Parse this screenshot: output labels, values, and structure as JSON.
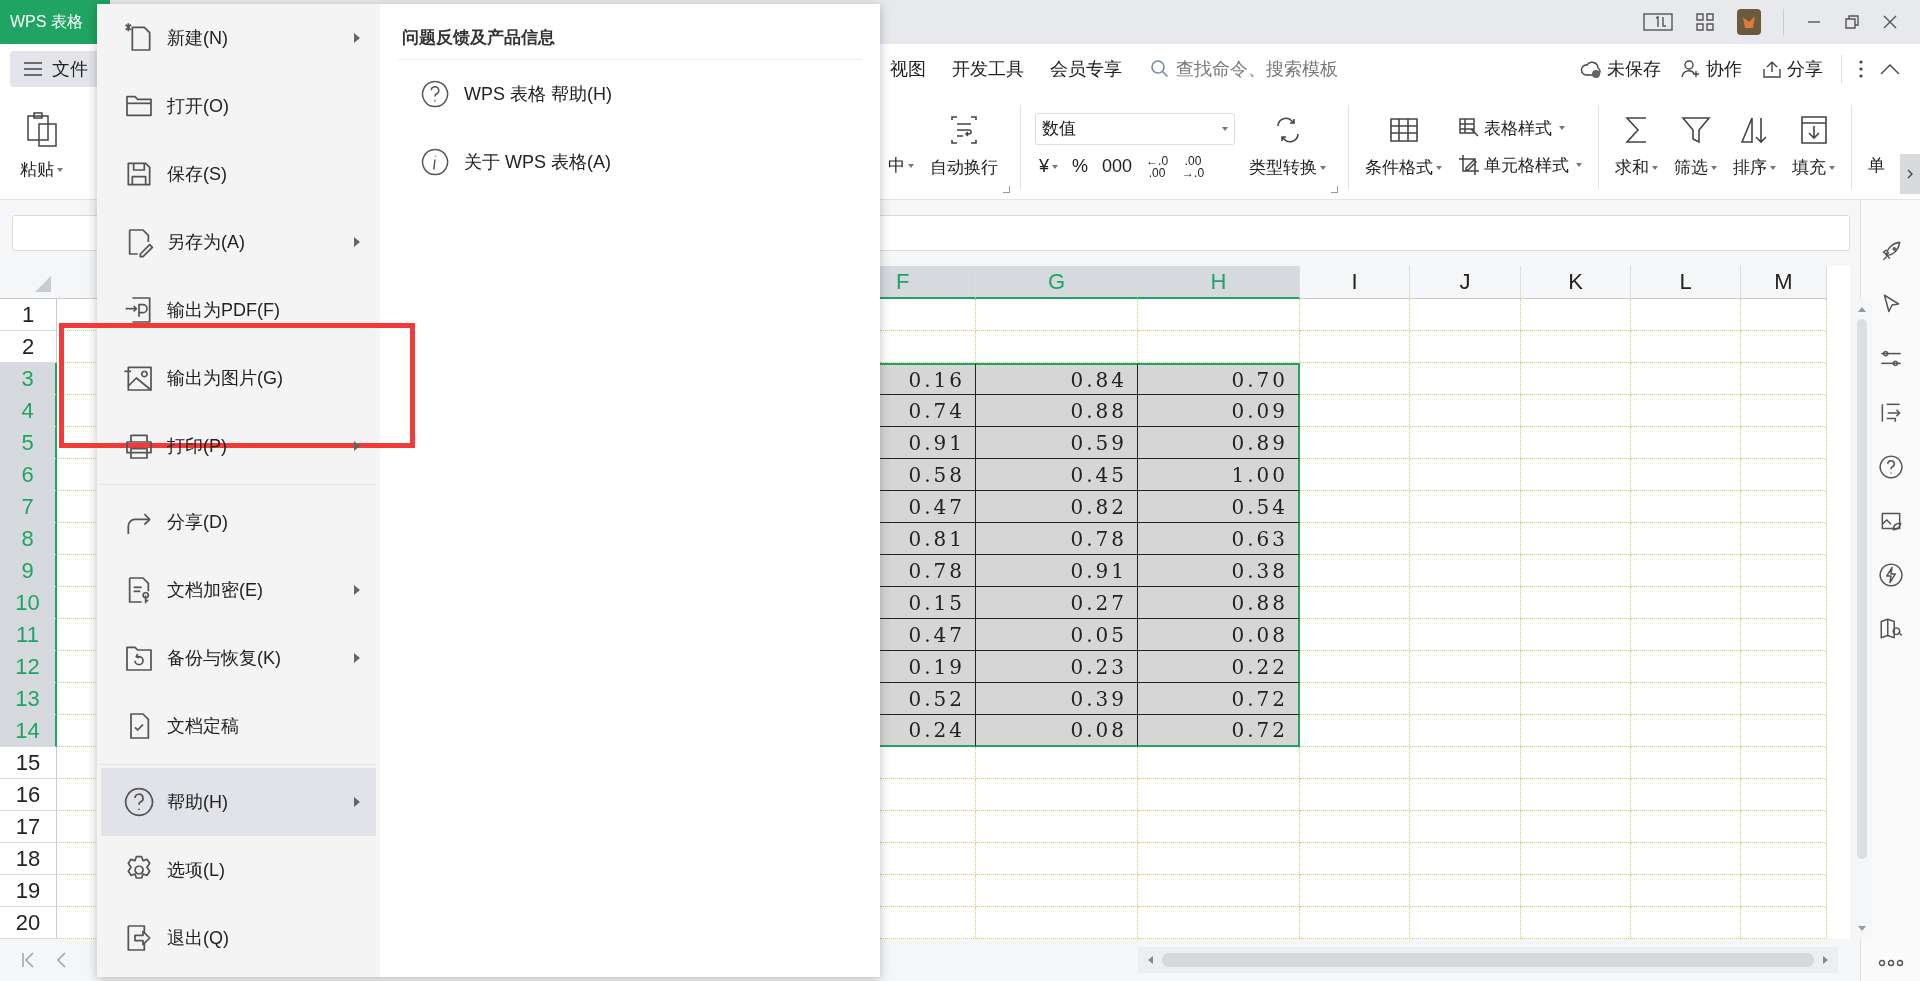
{
  "app_tab": {
    "label": "WPS 表格"
  },
  "file_button": {
    "label": "文件",
    "selected": true
  },
  "ribbon_tabs": [
    {
      "label": "视图",
      "selected": false
    },
    {
      "label": "开发工具",
      "selected": false
    },
    {
      "label": "会员专享",
      "selected": false
    }
  ],
  "search": {
    "placeholder": "查找命令、搜索模板"
  },
  "header_actions": [
    {
      "label": "未保存"
    },
    {
      "label": "协作"
    },
    {
      "label": "分享"
    }
  ],
  "ribbon_left": [
    {
      "label": "粘贴",
      "dropdown": true
    }
  ],
  "ribbon": [
    {
      "kind": "large",
      "label": "中",
      "dropdown": true
    },
    {
      "kind": "large",
      "label": "自动换行",
      "dropdown": false,
      "launcher": true
    },
    {
      "kind": "number",
      "value": "数值",
      "buttons": [
        {
          "label": "¥",
          "dropdown": true
        },
        {
          "label": "%",
          "dropdown": false
        },
        {
          "label": "000",
          "dropdown": false
        },
        {
          "label": "←.0",
          "sub": ".00"
        },
        {
          "label": ".00",
          "sub": "→.0"
        }
      ]
    },
    {
      "kind": "large",
      "label": "类型转换",
      "dropdown": true,
      "launcher": true
    },
    {
      "kind": "large",
      "label": "条件格式",
      "dropdown": true
    },
    {
      "kind": "stack",
      "items": [
        {
          "label": "表格样式",
          "dropdown": true
        },
        {
          "label": "单元格样式",
          "dropdown": true
        }
      ]
    },
    {
      "kind": "large",
      "label": "求和",
      "dropdown": true
    },
    {
      "kind": "large",
      "label": "筛选",
      "dropdown": true
    },
    {
      "kind": "large",
      "label": "排序",
      "dropdown": true
    },
    {
      "kind": "large",
      "label": "填充",
      "dropdown": true
    },
    {
      "kind": "large",
      "label": "单",
      "dropdown": false
    }
  ],
  "file_menu": {
    "groups": [
      [
        {
          "label": "新建(N)",
          "submenu": true,
          "selected": false,
          "annotated": false
        },
        {
          "label": "打开(O)",
          "submenu": false,
          "selected": false,
          "annotated": false
        },
        {
          "label": "保存(S)",
          "submenu": false,
          "selected": false,
          "annotated": false
        },
        {
          "label": "另存为(A)",
          "submenu": true,
          "selected": false,
          "annotated": false
        },
        {
          "label": "输出为PDF(F)",
          "submenu": false,
          "selected": false,
          "annotated": false
        },
        {
          "label": "输出为图片(G)",
          "submenu": false,
          "selected": false,
          "annotated": true
        },
        {
          "label": "打印(P)",
          "submenu": true,
          "selected": false,
          "annotated": false
        }
      ],
      [
        {
          "label": "分享(D)",
          "submenu": false,
          "selected": false,
          "annotated": false
        },
        {
          "label": "文档加密(E)",
          "submenu": true,
          "selected": false,
          "annotated": false
        },
        {
          "label": "备份与恢复(K)",
          "submenu": true,
          "selected": false,
          "annotated": false
        },
        {
          "label": "文档定稿",
          "submenu": false,
          "selected": false,
          "annotated": false
        }
      ],
      [
        {
          "label": "帮助(H)",
          "submenu": true,
          "selected": true,
          "annotated": false
        },
        {
          "label": "选项(L)",
          "submenu": false,
          "selected": false,
          "annotated": false
        },
        {
          "label": "退出(Q)",
          "submenu": false,
          "selected": false,
          "annotated": false
        }
      ]
    ]
  },
  "submenu": {
    "title": "问题反馈及产品信息",
    "items": [
      {
        "label": "WPS 表格 帮助(H)"
      },
      {
        "label": "关于 WPS 表格(A)"
      }
    ]
  },
  "columns": [
    {
      "label": "F",
      "selected": true
    },
    {
      "label": "G",
      "selected": true
    },
    {
      "label": "H",
      "selected": true
    },
    {
      "label": "I",
      "selected": false
    },
    {
      "label": "J",
      "selected": false
    },
    {
      "label": "K",
      "selected": false
    },
    {
      "label": "L",
      "selected": false
    },
    {
      "label": "M",
      "selected": false
    }
  ],
  "rows": [
    {
      "label": "1",
      "selected": false
    },
    {
      "label": "2",
      "selected": false
    },
    {
      "label": "3",
      "selected": true,
      "cells": [
        "0.16",
        "0.84",
        "0.70"
      ]
    },
    {
      "label": "4",
      "selected": true,
      "cells": [
        "0.74",
        "0.88",
        "0.09"
      ]
    },
    {
      "label": "5",
      "selected": true,
      "cells": [
        "0.91",
        "0.59",
        "0.89"
      ]
    },
    {
      "label": "6",
      "selected": true,
      "cells": [
        "0.58",
        "0.45",
        "1.00"
      ]
    },
    {
      "label": "7",
      "selected": true,
      "cells": [
        "0.47",
        "0.82",
        "0.54"
      ]
    },
    {
      "label": "8",
      "selected": true,
      "cells": [
        "0.81",
        "0.78",
        "0.63"
      ]
    },
    {
      "label": "9",
      "selected": true,
      "cells": [
        "0.78",
        "0.91",
        "0.38"
      ]
    },
    {
      "label": "10",
      "selected": true,
      "cells": [
        "0.15",
        "0.27",
        "0.88"
      ]
    },
    {
      "label": "11",
      "selected": true,
      "cells": [
        "0.47",
        "0.05",
        "0.08"
      ]
    },
    {
      "label": "12",
      "selected": true,
      "cells": [
        "0.19",
        "0.23",
        "0.22"
      ]
    },
    {
      "label": "13",
      "selected": true,
      "cells": [
        "0.52",
        "0.39",
        "0.72"
      ]
    },
    {
      "label": "14",
      "selected": true,
      "cells": [
        "0.24",
        "0.08",
        "0.72"
      ]
    },
    {
      "label": "15",
      "selected": false
    },
    {
      "label": "16",
      "selected": false
    },
    {
      "label": "17",
      "selected": false
    },
    {
      "label": "18",
      "selected": false
    },
    {
      "label": "19",
      "selected": false
    },
    {
      "label": "20",
      "selected": false
    }
  ]
}
